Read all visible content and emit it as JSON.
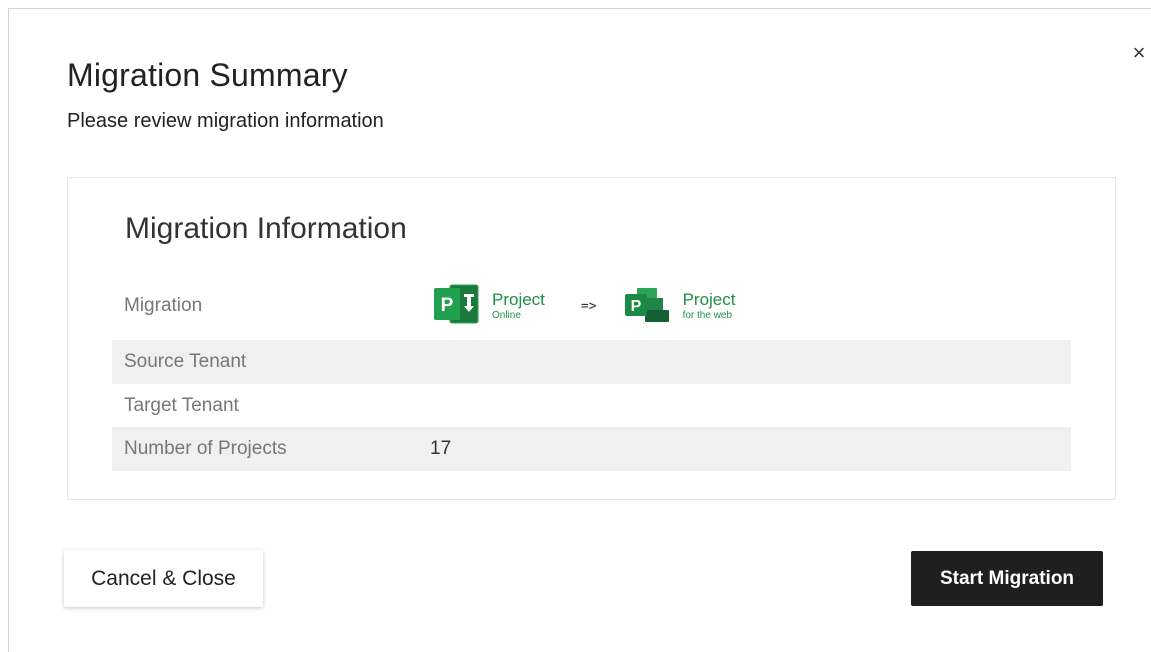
{
  "dialog": {
    "title": "Migration Summary",
    "subtitle": "Please review migration information",
    "close_glyph": "×"
  },
  "info_card": {
    "title": "Migration Information",
    "rows": [
      {
        "label": "Migration",
        "value": ""
      },
      {
        "label": "Source Tenant",
        "value": ""
      },
      {
        "label": "Target Tenant",
        "value": ""
      },
      {
        "label": "Number of Projects",
        "value": "17"
      }
    ],
    "migration": {
      "source": {
        "name": "Project",
        "sub": "Online",
        "icon": "project-online-icon"
      },
      "arrow": "=>",
      "target": {
        "name": "Project",
        "sub": "for the web",
        "icon": "project-for-the-web-icon"
      }
    }
  },
  "actions": {
    "cancel_label": "Cancel & Close",
    "start_label": "Start Migration"
  },
  "colors": {
    "brand_green": "#1f8f47",
    "row_shade": "#f0f0f0",
    "primary_button": "#1f1f1f"
  }
}
